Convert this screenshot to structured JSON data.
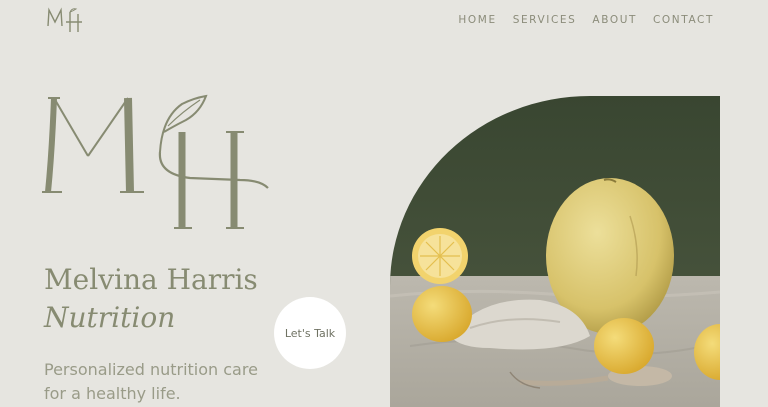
{
  "header": {
    "logo_alt": "MH",
    "nav": [
      {
        "label": "HOME"
      },
      {
        "label": "SERVICES"
      },
      {
        "label": "ABOUT"
      },
      {
        "label": "CONTACT"
      }
    ]
  },
  "hero": {
    "name": "Melvina Harris",
    "subtitle": "Nutrition",
    "tagline": "Personalized nutrition care for a healthy life.",
    "cta_label": "Let's Talk",
    "logo_letters": "MH"
  },
  "colors": {
    "background": "#e6e5e0",
    "accent": "#878b72",
    "photo_wall": "#3e4a35",
    "cta_bg": "#ffffff"
  }
}
